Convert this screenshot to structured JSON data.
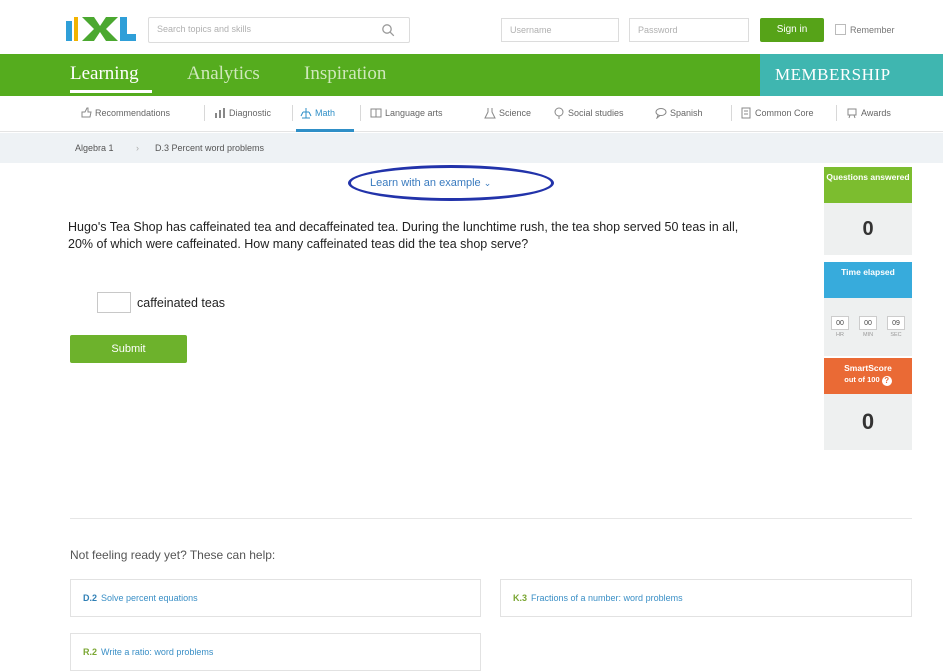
{
  "header": {
    "search_placeholder": "Search topics and skills",
    "username_placeholder": "Username",
    "password_placeholder": "Password",
    "signin_label": "Sign in",
    "remember_label": "Remember"
  },
  "main_nav": {
    "tabs": [
      "Learning",
      "Analytics",
      "Inspiration"
    ],
    "active": "Learning",
    "membership": "MEMBERSHIP"
  },
  "subject_nav": {
    "items": [
      {
        "label": "Recommendations",
        "icon": "recommendations-icon"
      },
      {
        "label": "Diagnostic",
        "icon": "diagnostic-icon"
      },
      {
        "label": "Math",
        "icon": "math-icon"
      },
      {
        "label": "Language arts",
        "icon": "language-arts-icon"
      },
      {
        "label": "Science",
        "icon": "science-icon"
      },
      {
        "label": "Social studies",
        "icon": "social-studies-icon"
      },
      {
        "label": "Spanish",
        "icon": "spanish-icon"
      },
      {
        "label": "Common Core",
        "icon": "common-core-icon"
      },
      {
        "label": "Awards",
        "icon": "awards-icon"
      }
    ],
    "active": "Math"
  },
  "breadcrumb": {
    "items": [
      "Algebra 1",
      "D.3 Percent word problems"
    ],
    "separator": "›"
  },
  "practice": {
    "learn_example": "Learn with an example",
    "question": "Hugo's Tea Shop has caffeinated tea and decaffeinated tea. During the lunchtime rush, the tea shop served 50 teas in all, 20% of which were caffeinated. How many caffeinated teas did the tea shop serve?",
    "answer_value": "",
    "answer_unit": "caffeinated teas",
    "submit_label": "Submit"
  },
  "stats": {
    "questions_answered_label": "Questions answered",
    "questions_answered": "0",
    "time_elapsed_label": "Time elapsed",
    "time": {
      "hr": "00",
      "min": "00",
      "sec": "09"
    },
    "time_units": {
      "hr": "HR",
      "min": "MIN",
      "sec": "SEC"
    },
    "smartscore_label": "SmartScore",
    "smartscore_sub": "out of 100",
    "smartscore": "0"
  },
  "help": {
    "title": "Not feeling ready yet? These can help:",
    "cards": [
      {
        "code": "D.2",
        "label": "Solve percent equations"
      },
      {
        "code": "K.3",
        "label": "Fractions of a number: word problems"
      },
      {
        "code": "R.2",
        "label": "Write a ratio: word problems"
      }
    ]
  },
  "colors": {
    "brand_green": "#55ac1e",
    "membership_teal": "#3fb6b0",
    "link_blue": "#3a7bbf",
    "time_blue": "#37abdc",
    "smartscore_orange": "#ea6a35",
    "highlight_oval": "#2233aa"
  }
}
